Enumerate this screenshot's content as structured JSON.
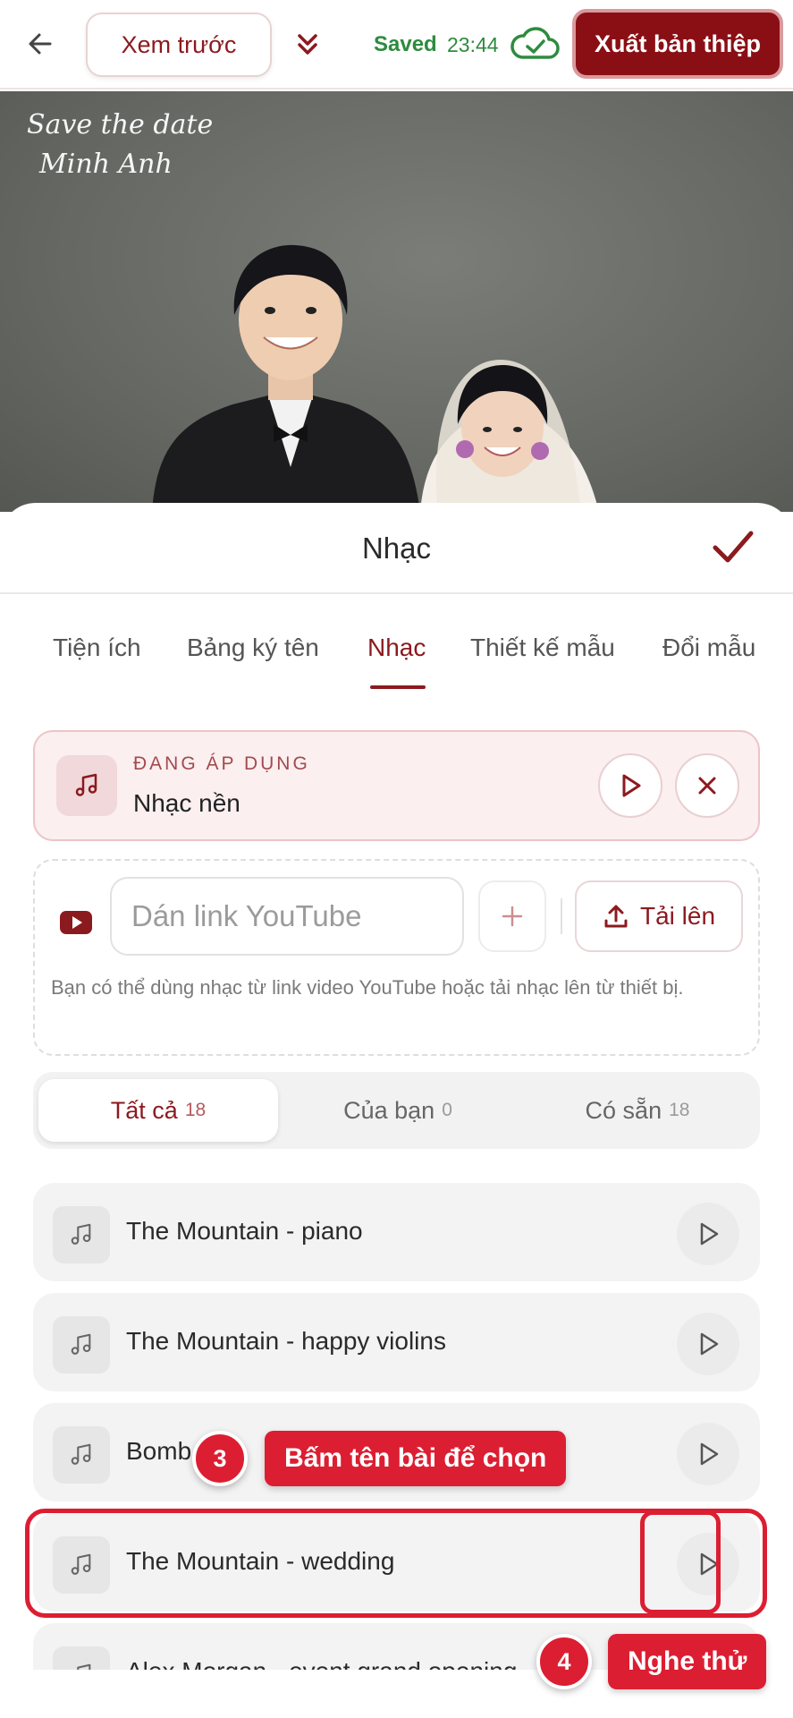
{
  "topbar": {
    "preview_label": "Xem trước",
    "saved_label": "Saved",
    "saved_time": "23:44",
    "export_label": "Xuất bản thiệp"
  },
  "photo": {
    "overlay_line1": "Save the date",
    "overlay_line2": "Minh Anh"
  },
  "sheet": {
    "title": "Nhạc",
    "tabs": [
      {
        "label": "Tiện ích"
      },
      {
        "label": "Bảng ký tên"
      },
      {
        "label": "Nhạc",
        "active": true
      },
      {
        "label": "Thiết kế mẫu"
      },
      {
        "label": "Đổi mẫu"
      }
    ],
    "applied": {
      "label": "ĐANG ÁP DỤNG",
      "name": "Nhạc nền"
    },
    "youtube": {
      "placeholder": "Dán link YouTube",
      "upload_label": "Tải lên",
      "hint": "Bạn có thể dùng nhạc từ link video YouTube hoặc tải nhạc lên từ thiết bị."
    },
    "filters": [
      {
        "label": "Tất cả",
        "count": "18",
        "active": true
      },
      {
        "label": "Của bạn",
        "count": "0"
      },
      {
        "label": "Có sẵn",
        "count": "18"
      }
    ],
    "tracks": [
      {
        "name": "The Mountain - piano"
      },
      {
        "name": "The Mountain - happy violins"
      },
      {
        "name": "Bomb"
      },
      {
        "name": "The Mountain - wedding"
      },
      {
        "name": "Alex Morgan - event grand opening"
      }
    ]
  },
  "callouts": {
    "step3_number": "3",
    "step3_text": "Bấm tên bài để chọn",
    "step4_number": "4",
    "step4_text": "Nghe thử"
  },
  "colors": {
    "brand": "#8a0f14",
    "callout": "#dc1e32",
    "saved": "#2e8b3e"
  }
}
